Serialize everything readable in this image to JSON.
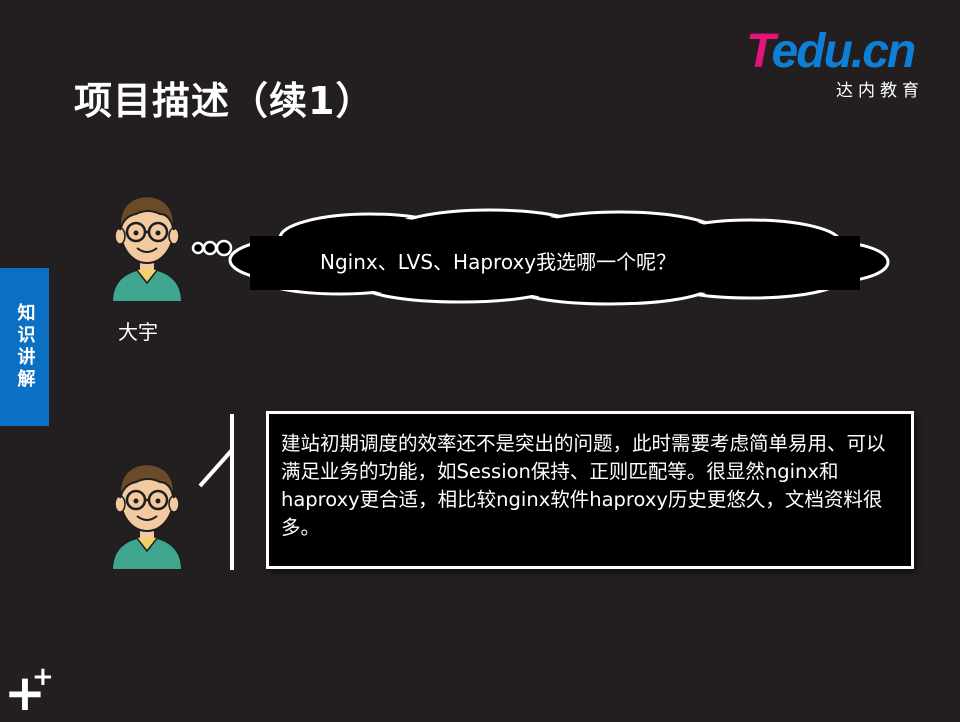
{
  "slide": {
    "title": "项目描述（续1）",
    "logo": {
      "brand_t": "T",
      "brand_rest": "edu.cn",
      "subtitle": "达内教育"
    },
    "side_tab": "知识讲解",
    "speaker": {
      "name": "大宇",
      "question": "Nginx、LVS、Haproxy我选哪一个呢？"
    },
    "answer": "建站初期调度的效率还不是突出的问题，此时需要考虑简单易用、可以满足业务的功能，如Session保持、正则匹配等。很显然nginx和haproxy更合适，相比较nginx软件haproxy历史更悠久，文档资料很多。",
    "corner_plus_big": "+",
    "corner_plus_small": "+"
  },
  "colors": {
    "background": "#231f20",
    "side_tab": "#0b6fc4",
    "logo_pink": "#e4147c",
    "logo_blue": "#0e7fd6",
    "avatar_shirt": "#3fa58e",
    "avatar_hair": "#6b4a2a"
  },
  "icons": {
    "avatar": "cartoon-man-with-glasses-icon",
    "thought": "thought-cloud-icon"
  }
}
